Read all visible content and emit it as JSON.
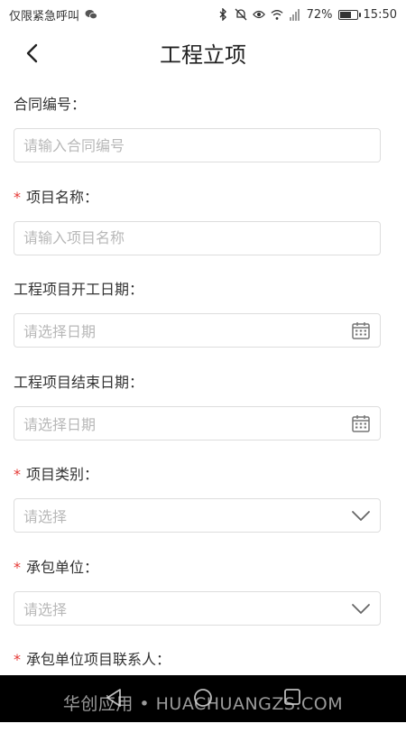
{
  "status_bar": {
    "left_text": "仅限紧急呼叫",
    "battery_percent": "72%",
    "battery_level": 0.72,
    "time": "15:50",
    "icons": [
      "wechat-icon",
      "bluetooth-icon",
      "mute-icon",
      "eye-icon",
      "wifi-icon",
      "signal-icon",
      "battery-icon"
    ]
  },
  "nav": {
    "title": "工程立项"
  },
  "form": {
    "fields": [
      {
        "label": "合同编号：",
        "required": false,
        "placeholder": "请输入合同编号",
        "type": "text"
      },
      {
        "label": "项目名称：",
        "required": true,
        "placeholder": "请输入项目名称",
        "type": "text"
      },
      {
        "label": "工程项目开工日期：",
        "required": false,
        "placeholder": "请选择日期",
        "type": "date"
      },
      {
        "label": "工程项目结束日期：",
        "required": false,
        "placeholder": "请选择日期",
        "type": "date"
      },
      {
        "label": "项目类别：",
        "required": true,
        "placeholder": "请选择",
        "type": "select"
      },
      {
        "label": "承包单位：",
        "required": true,
        "placeholder": "请选择",
        "type": "select"
      },
      {
        "label": "承包单位项目联系人：",
        "required": true
      }
    ],
    "required_mark": "*"
  },
  "watermark": "华创应用 • HUACHUANGZS.COM",
  "colors": {
    "required": "#e53935",
    "border": "#dddddd",
    "placeholder": "#b8b8b8"
  }
}
